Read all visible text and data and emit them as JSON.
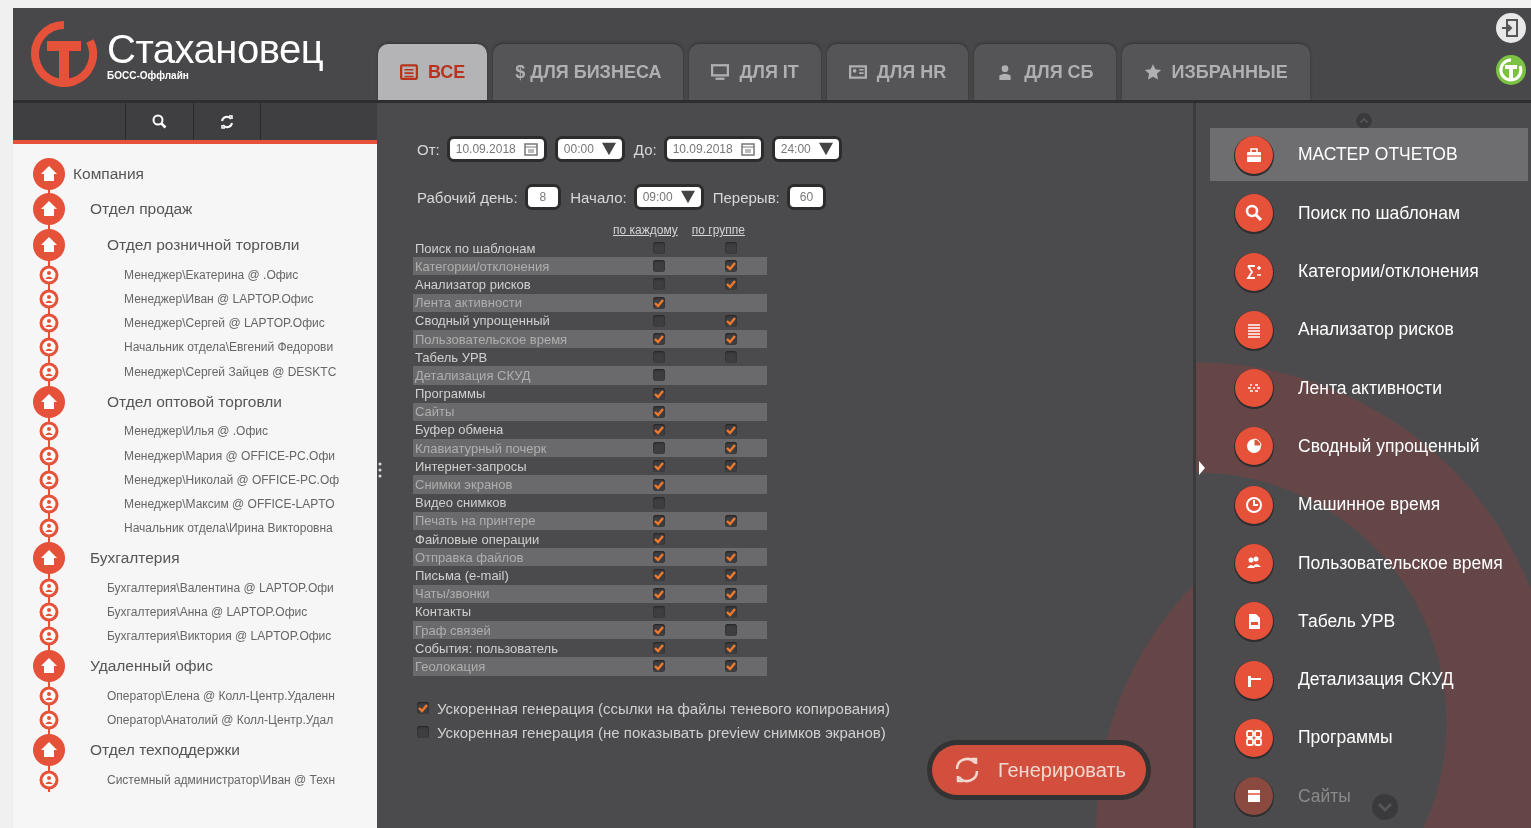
{
  "header": {
    "logo": {
      "title": "Стахановец",
      "subtitle": "БОСС-Оффлайн"
    },
    "tabs": [
      {
        "label": "ВСЕ",
        "selected": true
      },
      {
        "label": "$ ДЛЯ БИЗНЕСА",
        "selected": false
      },
      {
        "label": "ДЛЯ IT",
        "selected": false
      },
      {
        "label": "ДЛЯ HR",
        "selected": false
      },
      {
        "label": "ДЛЯ СБ",
        "selected": false
      },
      {
        "label": "ИЗБРАННЫЕ",
        "selected": false
      }
    ]
  },
  "tree": [
    {
      "kind": "group",
      "name": "Компания",
      "children": [
        {
          "kind": "group",
          "name": "Отдел продаж",
          "children": [
            {
              "kind": "group",
              "name": "Отдел розничной торговли",
              "children": [
                {
                  "kind": "user",
                  "name": "Менеджер\\Екатерина @ .Офис"
                },
                {
                  "kind": "user",
                  "name": "Менеджер\\Иван @ LAPTOP.Офис"
                },
                {
                  "kind": "user",
                  "name": "Менеджер\\Сергей @ LAPTOP.Офис"
                },
                {
                  "kind": "user",
                  "name": "Начальник отдела\\Евгений Федорови"
                },
                {
                  "kind": "user",
                  "name": "Менеджер\\Сергей Зайцев @ DESKTC"
                }
              ]
            },
            {
              "kind": "group",
              "name": "Отдел оптовой торговли",
              "children": [
                {
                  "kind": "user",
                  "name": "Менеджер\\Илья @ .Офис"
                },
                {
                  "kind": "user",
                  "name": "Менеджер\\Мария @ OFFICE-PC.Офи"
                },
                {
                  "kind": "user",
                  "name": "Менеджер\\Николай @ OFFICE-PC.Оф"
                },
                {
                  "kind": "user",
                  "name": "Менеджер\\Максим @ OFFICE-LAPTO"
                },
                {
                  "kind": "user",
                  "name": "Начальник отдела\\Ирина Викторовна"
                }
              ]
            }
          ]
        },
        {
          "kind": "group",
          "name": "Бухгалтерия",
          "children": [
            {
              "kind": "user",
              "name": "Бухгалтерия\\Валентина @ LAPTOP.Офи"
            },
            {
              "kind": "user",
              "name": "Бухгалтерия\\Анна @ LAPTOP.Офис"
            },
            {
              "kind": "user",
              "name": "Бухгалтерия\\Виктория @ LAPTOP.Офис"
            }
          ]
        },
        {
          "kind": "group",
          "name": "Удаленный офис",
          "children": [
            {
              "kind": "user",
              "name": "Оператор\\Елена @ Колл-Центр.Удаленн"
            },
            {
              "kind": "user",
              "name": "Оператор\\Анатолий @ Колл-Центр.Удал"
            }
          ]
        },
        {
          "kind": "group",
          "name": "Отдел техподдержки",
          "children": [
            {
              "kind": "user",
              "name": "Системный администратор\\Иван @ Техн"
            }
          ]
        }
      ]
    }
  ],
  "filters": {
    "from_label": "От:",
    "from_date": "10.09.2018",
    "from_time": "00:00",
    "to_label": "До:",
    "to_date": "10.09.2018",
    "to_time": "24:00",
    "workday_label": "Рабочий день:",
    "workday": "8",
    "start_label": "Начало:",
    "start_time": "09:00",
    "break_label": "Перерыв:",
    "break": "60"
  },
  "report_table": {
    "columns": [
      "по каждому",
      "по группе"
    ],
    "rows": [
      {
        "name": "Поиск по шаблонам",
        "per_each": false,
        "per_group": false
      },
      {
        "name": "Категории/отклонения",
        "per_each": false,
        "per_group": true
      },
      {
        "name": "Анализатор рисков",
        "per_each": false,
        "per_group": true
      },
      {
        "name": "Лента активности",
        "per_each": true
      },
      {
        "name": "Сводный упрощенный",
        "per_each": false,
        "per_group": true
      },
      {
        "name": "Пользовательское время",
        "per_each": true,
        "per_group": true
      },
      {
        "name": "Табель УРВ",
        "per_each": false,
        "per_group": false
      },
      {
        "name": "Детализация СКУД",
        "per_each": false
      },
      {
        "name": "Программы",
        "per_each": true
      },
      {
        "name": "Сайты",
        "per_each": true
      },
      {
        "name": "Буфер обмена",
        "per_each": true,
        "per_group": true
      },
      {
        "name": "Клавиатурный почерк",
        "per_each": false,
        "per_group": true
      },
      {
        "name": "Интернет-запросы",
        "per_each": true,
        "per_group": true
      },
      {
        "name": "Снимки экранов",
        "per_each": true
      },
      {
        "name": "Видео снимков",
        "per_each": false
      },
      {
        "name": "Печать на принтере",
        "per_each": true,
        "per_group": true
      },
      {
        "name": "Файловые операции",
        "per_each": true
      },
      {
        "name": "Отправка файлов",
        "per_each": true,
        "per_group": true
      },
      {
        "name": "Письма (e-mail)",
        "per_each": true,
        "per_group": true
      },
      {
        "name": "Чаты/звонки",
        "per_each": true,
        "per_group": true
      },
      {
        "name": "Контакты",
        "per_each": false,
        "per_group": true
      },
      {
        "name": "Граф связей",
        "per_each": true,
        "per_group": false
      },
      {
        "name": "События: пользователь",
        "per_each": true,
        "per_group": true
      },
      {
        "name": "Геолокация",
        "per_each": true,
        "per_group": true
      }
    ]
  },
  "options": [
    {
      "label": "Ускоренная генерация (ссылки на файлы теневого копирования)",
      "checked": true
    },
    {
      "label": "Ускоренная генерация (не показывать preview снимков экранов)",
      "checked": false
    }
  ],
  "generate_button": "Генерировать",
  "report_menu": [
    {
      "label": "МАСТЕР ОТЧЕТОВ",
      "selected": true
    },
    {
      "label": "Поиск по шаблонам",
      "selected": false
    },
    {
      "label": "Категории/отклонения",
      "selected": false
    },
    {
      "label": "Анализатор рисков",
      "selected": false
    },
    {
      "label": "Лента активности",
      "selected": false
    },
    {
      "label": "Сводный упрощенный",
      "selected": false
    },
    {
      "label": "Машинное время",
      "selected": false
    },
    {
      "label": "Пользовательское время",
      "selected": false
    },
    {
      "label": "Табель УРВ",
      "selected": false
    },
    {
      "label": "Детализация СКУД",
      "selected": false
    },
    {
      "label": "Программы",
      "selected": false
    },
    {
      "label": "Сайты",
      "selected": false
    }
  ]
}
